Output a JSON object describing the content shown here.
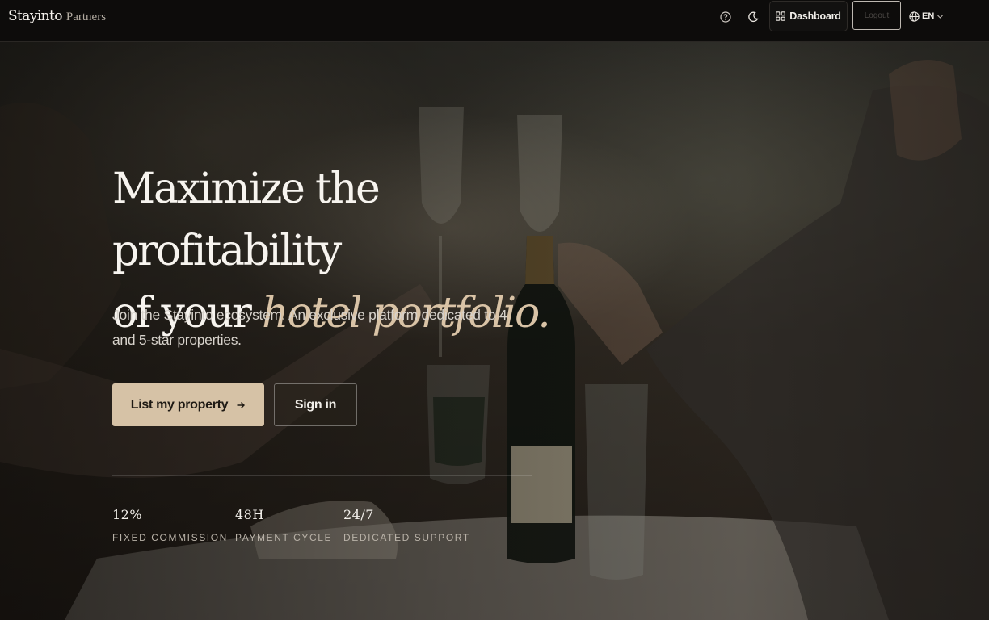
{
  "nav": {
    "brand_name": "Stayinto",
    "brand_suffix": "Partners",
    "help_icon": "help-circle-icon",
    "theme_icon": "moon-icon",
    "dashboard_label": "Dashboard",
    "dashboard_icon": "grid-icon",
    "logout_label": "Logout",
    "language_label": "EN",
    "language_icon": "globe-icon"
  },
  "hero": {
    "headline_line1": "Maximize the profitability",
    "headline_line2_prefix": "of your ",
    "headline_line2_accent": "hotel portfolio.",
    "subtitle": "Join the Stayinto ecosystem. An exclusive platform dedicated to 4 and 5-star properties.",
    "primary_cta": "List my property",
    "primary_cta_icon": "arrow-right-icon",
    "secondary_cta": "Sign in"
  },
  "stats": [
    {
      "value": "12%",
      "label": "FIXED COMMISSION"
    },
    {
      "value": "48H",
      "label": "PAYMENT CYCLE"
    },
    {
      "value": "24/7",
      "label": "DEDICATED SUPPORT"
    }
  ],
  "colors": {
    "accent": "#d6c2a6",
    "headline_accent": "#d9c3a6",
    "topbar": "#0d0c0b"
  }
}
